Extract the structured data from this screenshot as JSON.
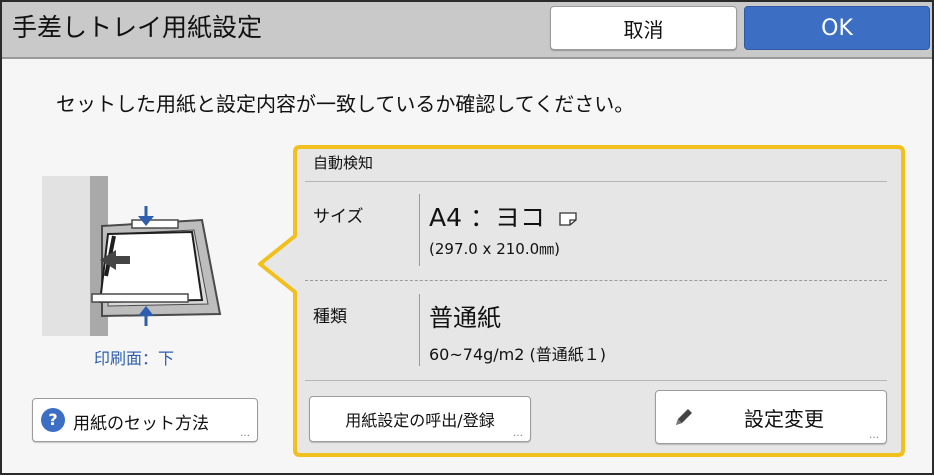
{
  "header": {
    "title": "手差しトレイ用紙設定",
    "cancel_label": "取消",
    "ok_label": "OK"
  },
  "instruction": "セットした用紙と設定内容が一致しているか確認してください。",
  "illustration": {
    "print_side_label": "印刷面：下"
  },
  "howto_button": {
    "icon": "question-icon",
    "icon_glyph": "?",
    "label": "用紙のセット方法",
    "more": "…"
  },
  "panel": {
    "auto_detect_label": "自動検知",
    "size": {
      "label": "サイズ",
      "value": "A4 ：ヨコ",
      "dimensions": "(297.0 x 210.0㎜)"
    },
    "type": {
      "label": "種類",
      "value": "普通紙",
      "detail": "60~74g/m2 (普通紙１)"
    },
    "recall_button": {
      "label": "用紙設定の呼出/登録",
      "more": "…"
    },
    "change_button": {
      "icon": "pencil-icon",
      "label": "設定変更",
      "more": "…"
    }
  },
  "colors": {
    "accent_blue": "#3c6fc4",
    "callout_border": "#f2c01c",
    "titlebar": "#c9c9c9"
  }
}
